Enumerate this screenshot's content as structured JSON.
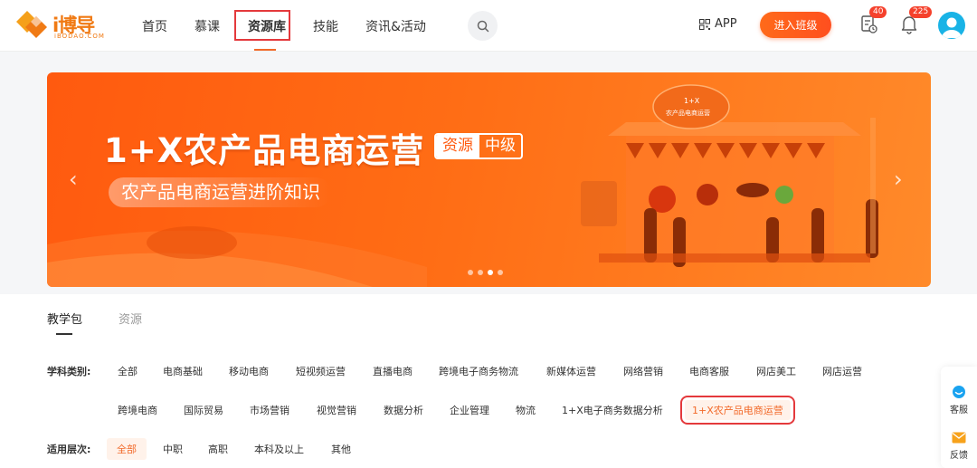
{
  "header": {
    "logo_text": "i博导",
    "logo_sub": "iBODAO.COM",
    "nav": [
      {
        "label": "首页"
      },
      {
        "label": "慕课"
      },
      {
        "label": "资源库"
      },
      {
        "label": "技能"
      },
      {
        "label": "资讯&活动"
      }
    ],
    "app_label": "APP",
    "enter_class_label": "进入班级",
    "task_badge": "40",
    "notify_badge": "225"
  },
  "banner": {
    "title": "1+X农产品电商运营",
    "tag_left": "资源",
    "tag_right": "中级",
    "subtitle": "农产品电商运营进阶知识",
    "shop_sign_line1": "1+X",
    "shop_sign_line2": "农产品电商运营",
    "slide_count": 4,
    "active_slide": 3
  },
  "tabs": [
    {
      "label": "教学包"
    },
    {
      "label": "资源"
    }
  ],
  "filters": {
    "subject_label": "学科类别:",
    "subjects_row1": [
      "全部",
      "电商基础",
      "移动电商",
      "短视频运营",
      "直播电商",
      "跨境电子商务物流",
      "新媒体运营",
      "网络营销",
      "电商客服",
      "网店美工",
      "网店运营"
    ],
    "subjects_row2": [
      "跨境电商",
      "国际贸易",
      "市场营销",
      "视觉营销",
      "数据分析",
      "企业管理",
      "物流",
      "1+X电子商务数据分析",
      "1+X农产品电商运营"
    ],
    "level_label": "适用层次:",
    "levels": [
      "全部",
      "中职",
      "高职",
      "本科及以上",
      "其他"
    ]
  },
  "side_panel": {
    "service_label": "客服",
    "feedback_label": "反馈"
  },
  "colors": {
    "accent": "#f26a2a",
    "highlight_box": "#e4393c",
    "banner_start": "#ff5a0f",
    "banner_end": "#ff8a2a"
  }
}
